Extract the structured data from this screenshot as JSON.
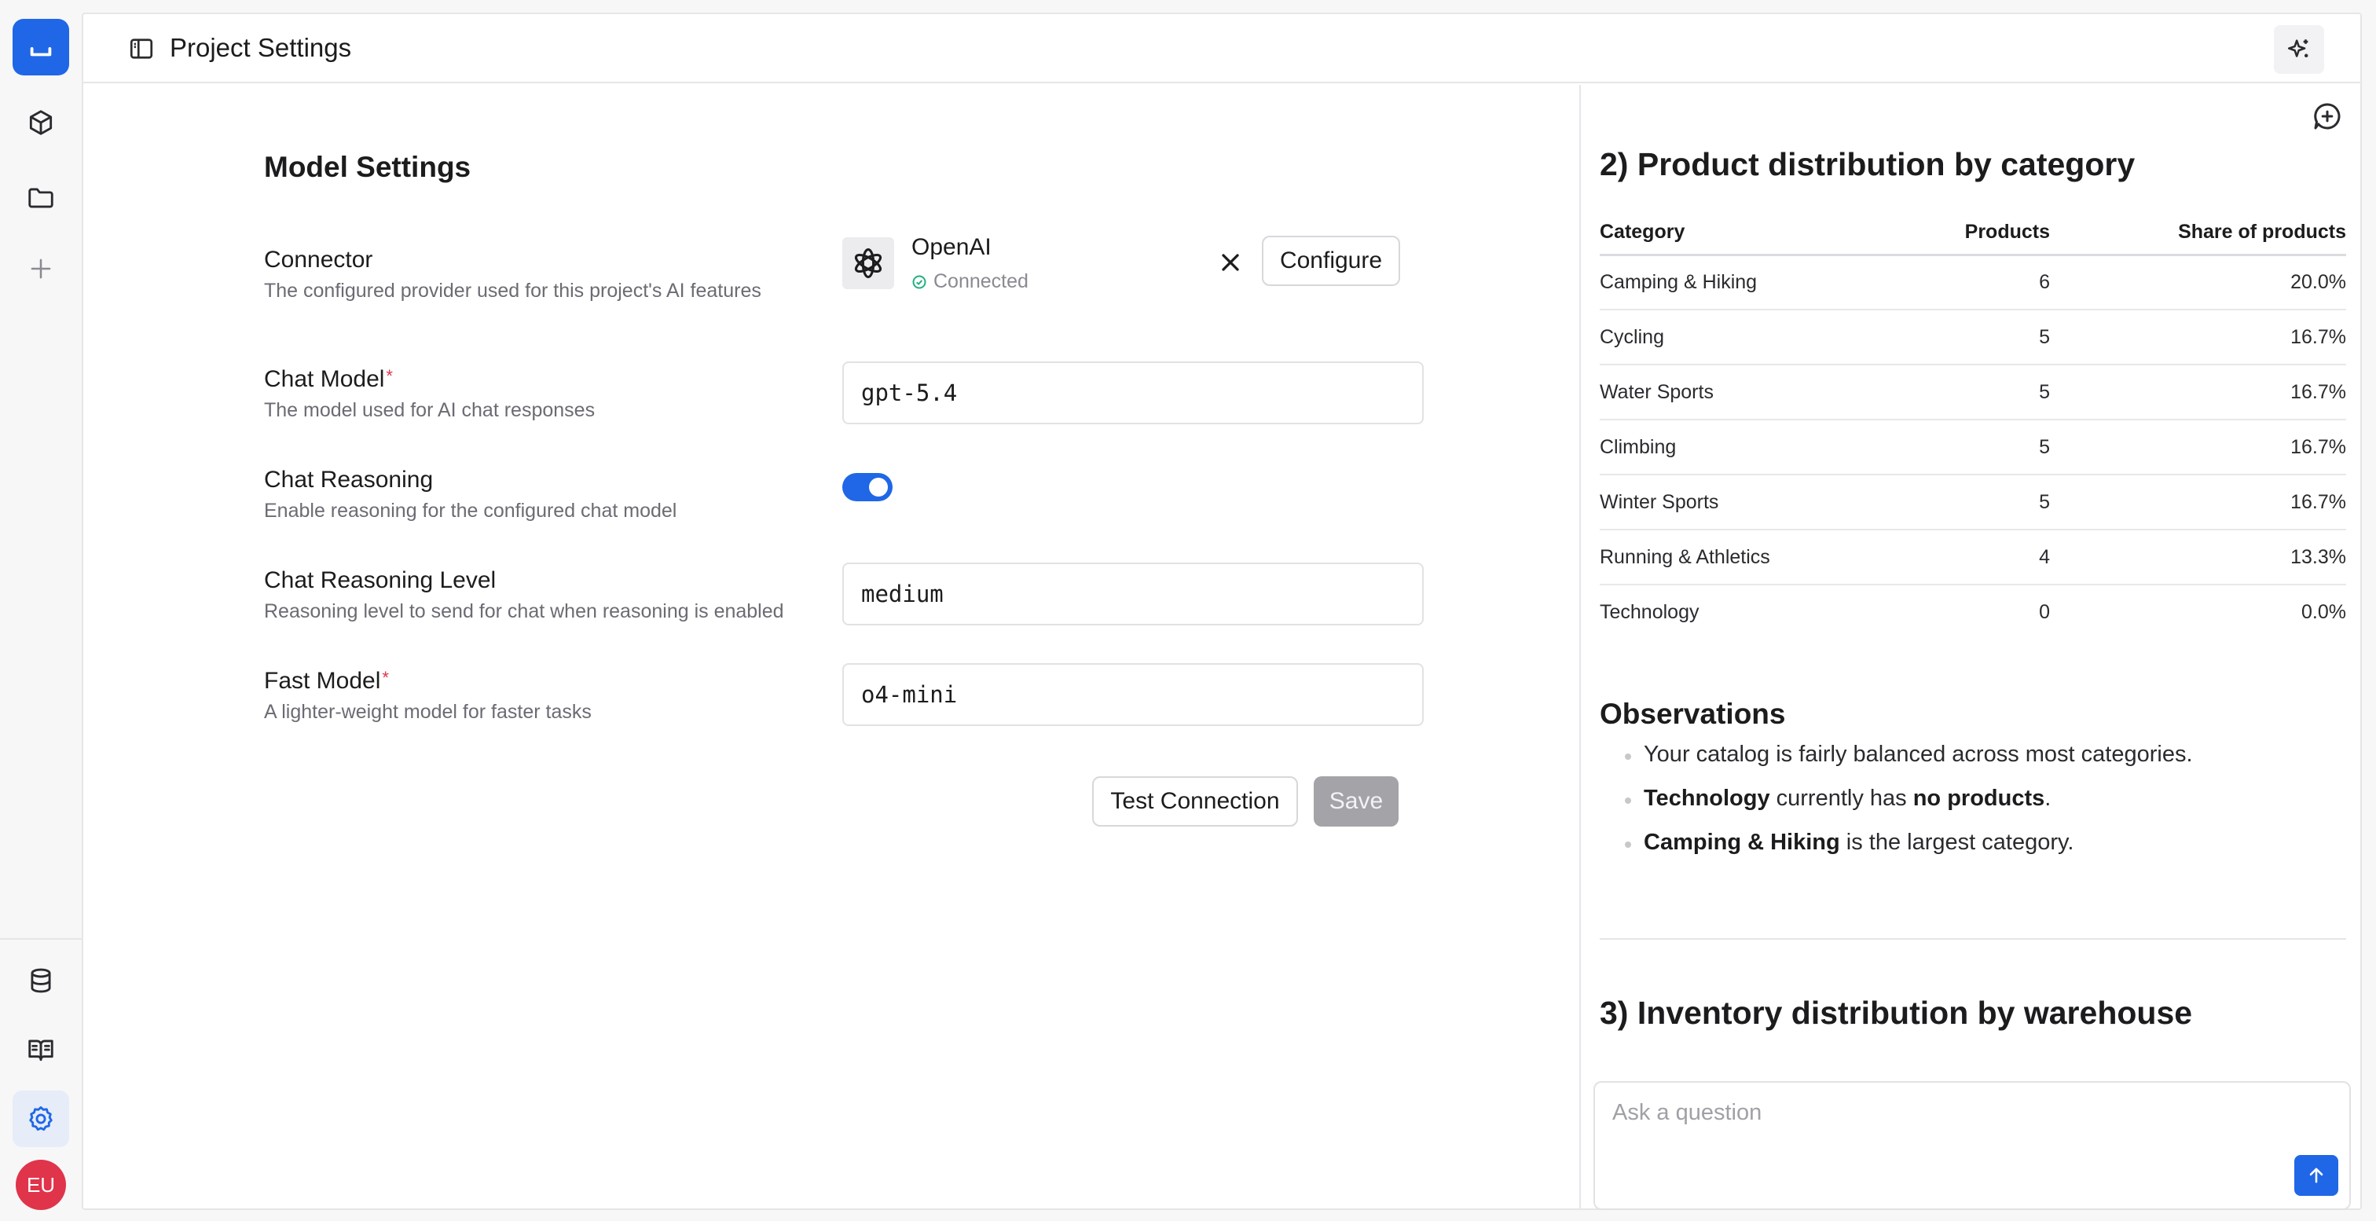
{
  "header": {
    "title": "Project Settings"
  },
  "settings": {
    "section_title": "Model Settings",
    "connector": {
      "label": "Connector",
      "description": "The configured provider used for this project's AI features",
      "provider": "OpenAI",
      "status": "Connected",
      "configure_label": "Configure"
    },
    "chat_model": {
      "label": "Chat Model",
      "required_mark": "*",
      "description": "The model used for AI chat responses",
      "value": "gpt-5.4"
    },
    "chat_reasoning": {
      "label": "Chat Reasoning",
      "description": "Enable reasoning for the configured chat model",
      "enabled": true
    },
    "chat_reasoning_level": {
      "label": "Chat Reasoning Level",
      "description": "Reasoning level to send for chat when reasoning is enabled",
      "value": "medium"
    },
    "fast_model": {
      "label": "Fast Model",
      "required_mark": "*",
      "description": "A lighter-weight model for faster tasks",
      "value": "o4-mini"
    },
    "test_connection_label": "Test Connection",
    "save_label": "Save"
  },
  "chat": {
    "heading_category": "2) Product distribution by category",
    "table": {
      "headers": [
        "Category",
        "Products",
        "Share of products"
      ],
      "rows": [
        [
          "Camping & Hiking",
          "6",
          "20.0%"
        ],
        [
          "Cycling",
          "5",
          "16.7%"
        ],
        [
          "Water Sports",
          "5",
          "16.7%"
        ],
        [
          "Climbing",
          "5",
          "16.7%"
        ],
        [
          "Winter Sports",
          "5",
          "16.7%"
        ],
        [
          "Running & Athletics",
          "4",
          "13.3%"
        ],
        [
          "Technology",
          "0",
          "0.0%"
        ]
      ]
    },
    "observations_title": "Observations",
    "observations": {
      "o1": "Your catalog is fairly balanced across most categories.",
      "o2_bold": "Technology",
      "o2_mid": " currently has ",
      "o2_bold2": "no products",
      "o2_end": ".",
      "o3_bold": "Camping & Hiking",
      "o3_end": " is the largest category."
    },
    "heading_warehouse": "3) Inventory distribution by warehouse",
    "ask_placeholder": "Ask a question"
  },
  "user": {
    "initials": "EU"
  },
  "colors": {
    "accent": "#1f67e6",
    "avatar": "#e0344a",
    "connected": "#22b07d",
    "required": "#e0344a"
  },
  "icons": {
    "rail": [
      "logo-icon",
      "cube-icon",
      "folder-icon",
      "plus-icon",
      "database-icon",
      "book-open-icon",
      "gear-icon"
    ],
    "header": [
      "sidebar-toggle-icon",
      "sparkle-icon"
    ],
    "chat": [
      "new-chat-icon",
      "arrow-up-icon"
    ]
  }
}
